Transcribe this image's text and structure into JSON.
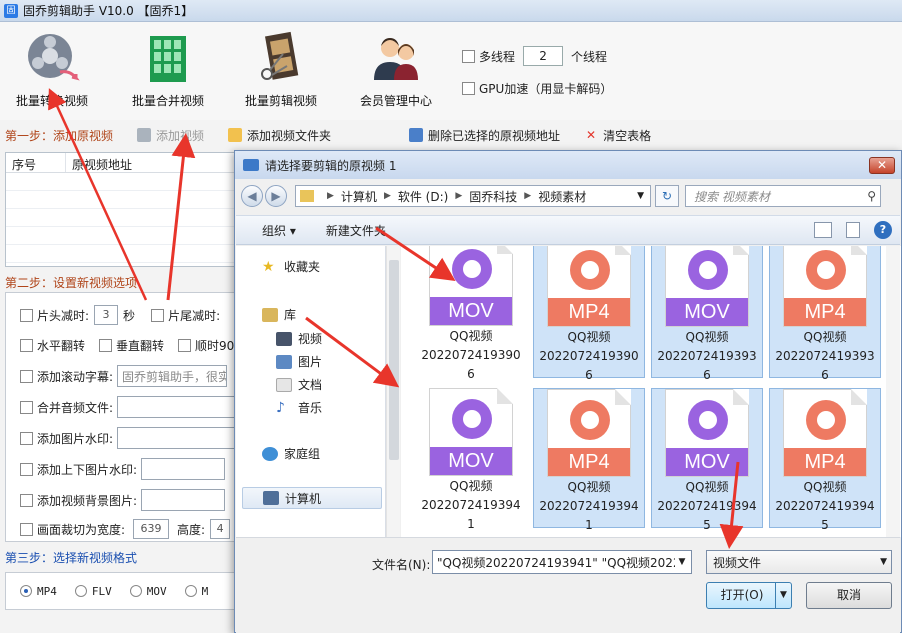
{
  "app": {
    "title": "固乔剪辑助手 V10.0  【固乔1】",
    "logo_text": "固"
  },
  "toolbar": {
    "batch_convert": "批量转换视频",
    "batch_merge": "批量合并视频",
    "batch_clip": "批量剪辑视频",
    "member_center": "会员管理中心",
    "multithread_label": "多线程",
    "thread_count": "2",
    "thread_unit": "个线程",
    "gpu_label": "GPU加速（用显卡解码）"
  },
  "step1": {
    "title": "第一步：添加原视频",
    "add_video": "添加视频",
    "add_folder": "添加视频文件夹",
    "delete_selected": "删除已选择的原视频地址",
    "clear_table": "清空表格"
  },
  "list": {
    "col_index": "序号",
    "col_path": "原视频地址"
  },
  "step2": {
    "title": "第二步：设置新视频选项",
    "head_cut": "片头减时:",
    "head_cut_value": "3",
    "seconds": "秒",
    "tail_cut": "片尾减时:",
    "hflip": "水平翻转",
    "vflip": "垂直翻转",
    "rotate": "顺时90",
    "scroll_caption": "添加滚动字幕:",
    "scroll_caption_value": "固乔剪辑助手，很实用",
    "merge_audio": "合并音频文件:",
    "image_watermark": "添加图片水印:",
    "top_bottom_watermark": "添加上下图片水印:",
    "bg_image": "添加视频背景图片:",
    "crop_width": "画面裁切为宽度:",
    "crop_width_value": "639",
    "crop_height": "高度:",
    "crop_height_value": "4"
  },
  "step3": {
    "title": "第三步：选择新视频格式",
    "formats": [
      "MP4",
      "FLV",
      "MOV",
      "M"
    ],
    "selected": "MP4"
  },
  "dialog": {
    "title": "请选择要剪辑的原视频 1",
    "close": "✕",
    "path": [
      "计算机",
      "软件 (D:)",
      "固乔科技",
      "视频素材"
    ],
    "search_placeholder": "搜索 视频素材",
    "organize": "组织 ▾",
    "new_folder": "新建文件夹",
    "nav": {
      "favorites": "收藏夹",
      "library": "库",
      "videos": "视频",
      "pictures": "图片",
      "documents": "文档",
      "music": "音乐",
      "homegroup": "家庭组",
      "computer": "计算机"
    },
    "files": [
      {
        "ext": "MOV",
        "name1": "QQ视频",
        "name2": "2022072419390",
        "name3": "6",
        "selected": false
      },
      {
        "ext": "MP4",
        "name1": "QQ视频",
        "name2": "2022072419390",
        "name3": "6",
        "selected": true
      },
      {
        "ext": "MOV",
        "name1": "QQ视频",
        "name2": "2022072419393",
        "name3": "6",
        "selected": true
      },
      {
        "ext": "MP4",
        "name1": "QQ视频",
        "name2": "2022072419393",
        "name3": "6",
        "selected": true
      },
      {
        "ext": "MOV",
        "name1": "QQ视频",
        "name2": "2022072419394",
        "name3": "1",
        "selected": false
      },
      {
        "ext": "MP4",
        "name1": "QQ视频",
        "name2": "2022072419394",
        "name3": "1",
        "selected": true
      },
      {
        "ext": "MOV",
        "name1": "QQ视频",
        "name2": "2022072419394",
        "name3": "5",
        "selected": true
      },
      {
        "ext": "MP4",
        "name1": "QQ视频",
        "name2": "2022072419394",
        "name3": "5",
        "selected": true
      }
    ],
    "filename_label": "文件名(N):",
    "filename_value": "\"QQ视频20220724193941\" \"QQ视频2022",
    "filetype": "视频文件",
    "open": "打开(O)",
    "cancel": "取消"
  },
  "colors": {
    "mov": "#9a63e0",
    "mp4": "#ee7a62",
    "arrow": "#e8352b"
  }
}
